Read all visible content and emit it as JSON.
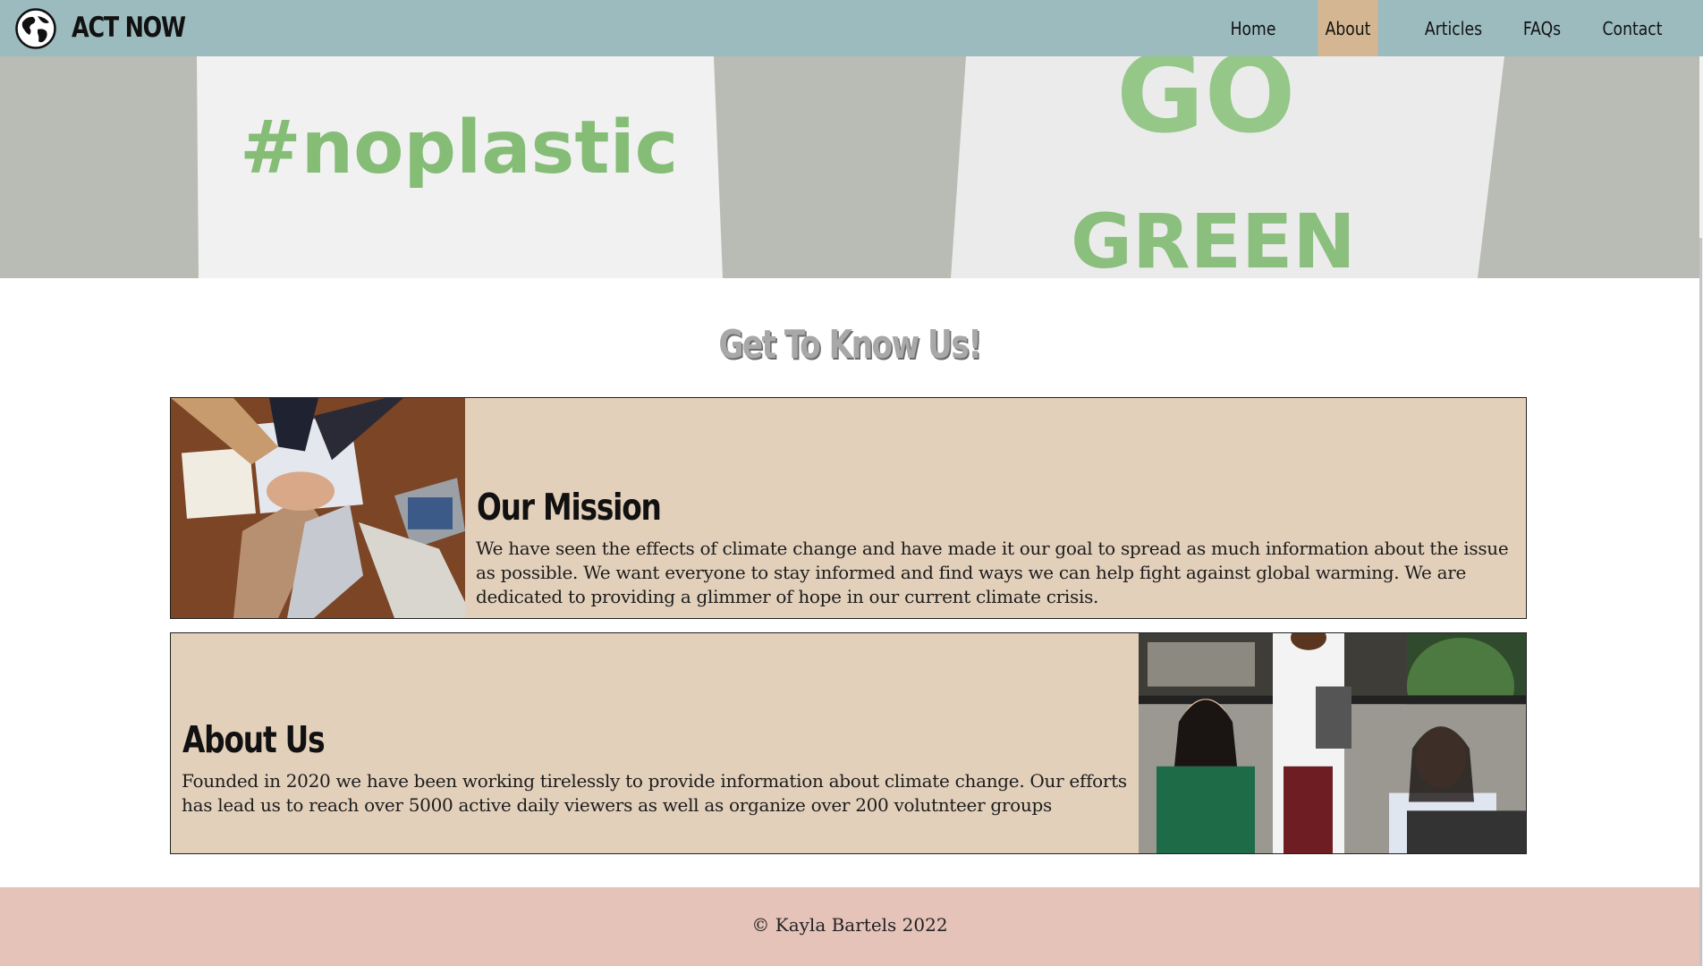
{
  "header": {
    "brand": "ACT NOW",
    "logo_icon": "globe-icon",
    "nav": [
      {
        "label": "Home",
        "active": false
      },
      {
        "label": "About",
        "active": true
      },
      {
        "label": "Articles",
        "active": false
      },
      {
        "label": "FAQs",
        "active": false
      },
      {
        "label": "Contact",
        "active": false
      }
    ]
  },
  "hero": {
    "sign_left": "#noplastic",
    "sign_right_line1": "GO",
    "sign_right_line2": "GREEN"
  },
  "main": {
    "section_title": "Get To Know Us!",
    "cards": [
      {
        "heading": "Our Mission",
        "text": "We have seen the effects of climate change and have made it our goal to spread as much information about the issue as possible. We want everyone to stay informed and find ways we can help fight against global warming. We are dedicated to providing a glimmer of hope in our current climate crisis."
      },
      {
        "heading": "About Us",
        "text": "Founded in 2020 we have been working tirelessly to provide information about climate change. Our efforts has lead us to reach over 5000 active daily viewers as well as organize over 200 volutnteer groups"
      }
    ]
  },
  "footer": {
    "text": "© Kayla Bartels 2022"
  },
  "colors": {
    "header_bg": "#9cbbbf",
    "nav_active_bg": "#d4b792",
    "card_bg": "#e3d0bb",
    "footer_bg": "#e6c3b9",
    "hero_sign_text": "#7ab86a"
  }
}
